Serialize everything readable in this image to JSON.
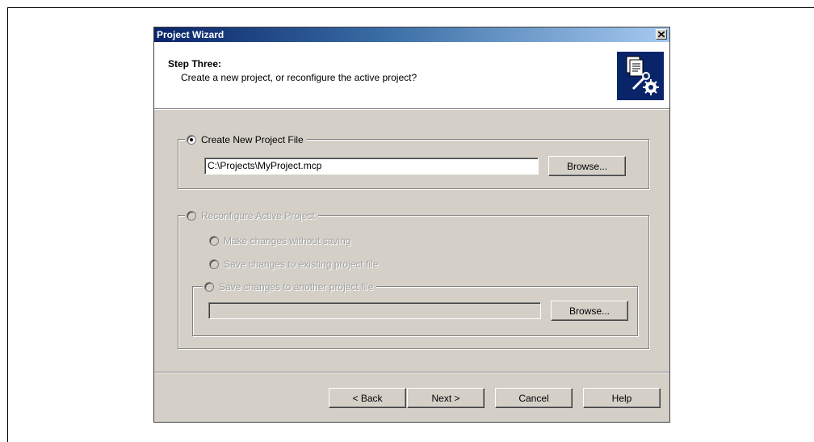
{
  "dialog": {
    "title": "Project Wizard",
    "close_glyph": "✕"
  },
  "header": {
    "step_title": "Step Three:",
    "step_description": "Create a new project, or reconfigure the active project?"
  },
  "create_group": {
    "label": "Create New Project File",
    "selected": true,
    "path_value": "C:\\Projects\\MyProject.mcp",
    "browse_label": "Browse..."
  },
  "reconfigure_group": {
    "label": "Reconfigure Active Project",
    "enabled": false,
    "options": [
      "Make changes without saving",
      "Save changes to existing project file"
    ],
    "another_file": {
      "label": "Save changes to another project file",
      "path_value": "",
      "browse_label": "Browse..."
    }
  },
  "footer": {
    "back_label": "< Back",
    "next_label": "Next >",
    "cancel_label": "Cancel",
    "help_label": "Help"
  },
  "colors": {
    "dialog_face": "#d4d0c8",
    "titlebar_start": "#0a246a",
    "titlebar_end": "#a6caf0",
    "disabled_text": "#a0a0a0"
  }
}
